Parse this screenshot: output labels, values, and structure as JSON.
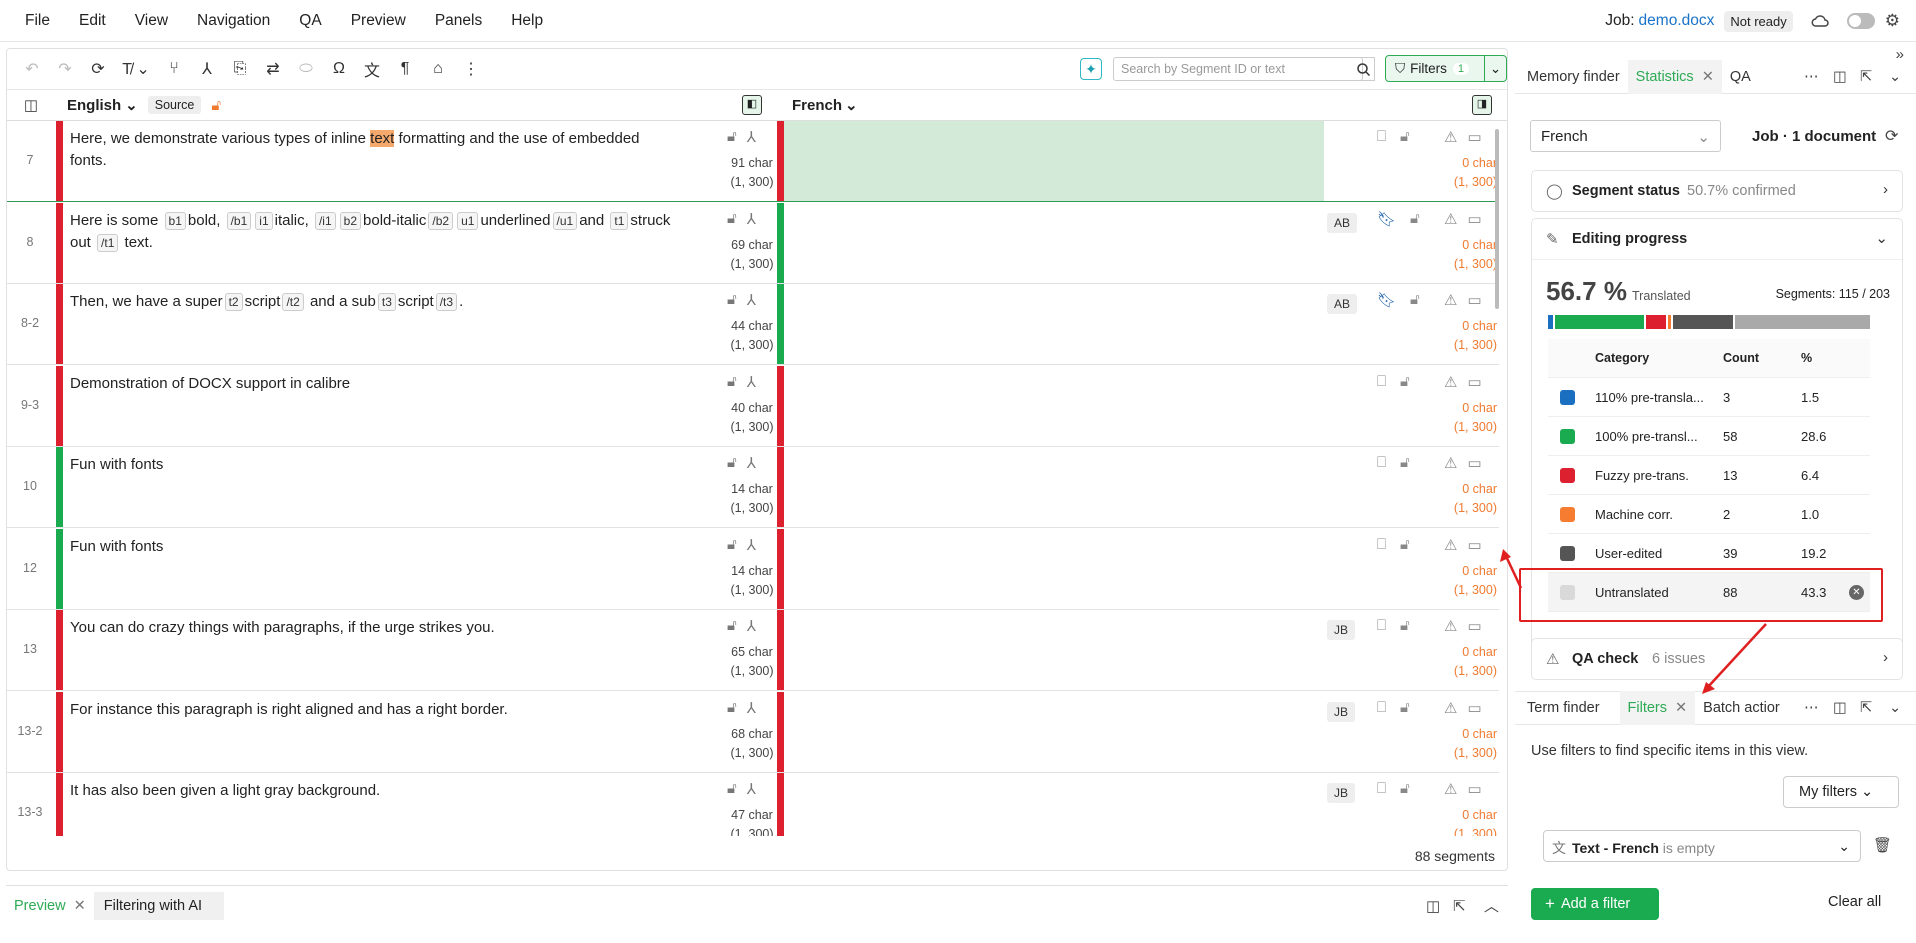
{
  "menu": [
    "File",
    "Edit",
    "View",
    "Navigation",
    "QA",
    "Preview",
    "Panels",
    "Help"
  ],
  "job": {
    "label": "Job:",
    "name": "demo.docx",
    "status": "Not ready"
  },
  "toolbar": {
    "search_placeholder": "Search by Segment ID or text",
    "filters_label": "Filters",
    "filters_count": "1"
  },
  "source_lang": "English",
  "source_badge": "Source",
  "target_lang": "French",
  "segments": [
    {
      "id": "7",
      "status_color": "#dd2030",
      "tgt_color": "#dd2030",
      "chars": "91 char",
      "range": "(1, 300)",
      "user": "",
      "bookmark": false
    },
    {
      "id": "8",
      "status_color": "#dd2030",
      "tgt_color": "#1aaa50",
      "chars": "69 char",
      "range": "(1, 300)",
      "user": "AB",
      "bookmark": true
    },
    {
      "id": "8-2",
      "status_color": "#dd2030",
      "tgt_color": "#1aaa50",
      "chars": "44 char",
      "range": "(1, 300)",
      "user": "AB",
      "bookmark": true
    },
    {
      "id": "9-3",
      "status_color": "#dd2030",
      "tgt_color": "#dd2030",
      "chars": "40 char",
      "range": "(1, 300)",
      "user": "",
      "bookmark": false
    },
    {
      "id": "10",
      "status_color": "#1aaa50",
      "tgt_color": "#dd2030",
      "chars": "14 char",
      "range": "(1, 300)",
      "user": "",
      "bookmark": false
    },
    {
      "id": "12",
      "status_color": "#1aaa50",
      "tgt_color": "#dd2030",
      "chars": "14 char",
      "range": "(1, 300)",
      "user": "",
      "bookmark": false
    },
    {
      "id": "13",
      "status_color": "#dd2030",
      "tgt_color": "#dd2030",
      "chars": "65 char",
      "range": "(1, 300)",
      "user": "JB",
      "bookmark": false
    },
    {
      "id": "13-2",
      "status_color": "#dd2030",
      "tgt_color": "#dd2030",
      "chars": "68 char",
      "range": "(1, 300)",
      "user": "JB",
      "bookmark": false
    },
    {
      "id": "13-3",
      "status_color": "#dd2030",
      "tgt_color": "#dd2030",
      "chars": "47 char",
      "range": "(1, 300)",
      "user": "JB",
      "bookmark": false
    }
  ],
  "seg_texts": {
    "s7a": "Here, we demonstrate various types of inline ",
    "s7hl": "text",
    "s7b": " formatting and the use of embedded fonts.",
    "s8": [
      "Here is some ",
      "b1",
      "bold, ",
      "/b1",
      "i1",
      "italic, ",
      "/i1",
      "b2",
      "bold-italic",
      "/b2",
      "u1",
      "underlined",
      "/u1",
      "and ",
      "t1",
      "struck out ",
      "/t1",
      " text."
    ],
    "s82": [
      "Then, we have a super",
      "t2",
      "script",
      "/t2",
      " and a sub",
      "t3",
      "script",
      "/t3",
      "."
    ],
    "s93": "Demonstration of DOCX support in calibre",
    "s10": "Fun with fonts",
    "s12": "Fun with fonts",
    "s13": "You can do crazy things with paragraphs, if the urge strikes you.",
    "s132": "For instance this paragraph is right aligned and has a right border.",
    "s133": "It has also been given a light gray background."
  },
  "target_chars": "0 char",
  "target_range": "(1, 300)",
  "segments_total": "88 segments",
  "bottom_tabs": [
    "Preview",
    "Filtering with AI"
  ],
  "panel_top": {
    "tabs": [
      "Memory finder",
      "Statistics",
      "QA"
    ],
    "active": "Statistics",
    "language": "French",
    "job_summary": "Job · 1 document",
    "segment_status": "Segment status",
    "segment_status_val": "50.7% confirmed",
    "editing_progress": "Editing progress",
    "percent": "56.7 %",
    "translated": "Translated",
    "segments_label": "Segments: 115 / 203",
    "progress": [
      {
        "color": "#1a6fc0",
        "value": 1.5
      },
      {
        "color": "#1aaa50",
        "value": 28.6
      },
      {
        "color": "#dd2030",
        "value": 6.4
      },
      {
        "color": "#f57c30",
        "value": 1.0
      },
      {
        "color": "#555555",
        "value": 19.2
      },
      {
        "color": "#a9a9a9",
        "value": 43.3
      }
    ],
    "table_headers": [
      "Category",
      "Count",
      "%"
    ],
    "rows": [
      {
        "color": "#1a6fc0",
        "cat": "110% pre-transla...",
        "count": "3",
        "pct": "1.5"
      },
      {
        "color": "#1aaa50",
        "cat": "100% pre-transl...",
        "count": "58",
        "pct": "28.6"
      },
      {
        "color": "#dd2030",
        "cat": "Fuzzy pre-trans.",
        "count": "13",
        "pct": "6.4"
      },
      {
        "color": "#f57c30",
        "cat": "Machine corr.",
        "count": "2",
        "pct": "1.0"
      },
      {
        "color": "#555555",
        "cat": "User-edited",
        "count": "39",
        "pct": "19.2"
      },
      {
        "color": "#d9d9d9",
        "cat": "Untranslated",
        "count": "88",
        "pct": "43.3"
      }
    ],
    "qa_check": "QA check",
    "qa_issues": "6 issues"
  },
  "panel_bottom": {
    "tabs": [
      "Term finder",
      "Filters",
      "Batch actior"
    ],
    "active": "Filters",
    "hint": "Use filters to find specific items in this view.",
    "my_filters": "My filters",
    "filter_field": "Text - French",
    "filter_cond": "is empty",
    "add_filter": "Add a filter",
    "clear_all": "Clear all"
  }
}
